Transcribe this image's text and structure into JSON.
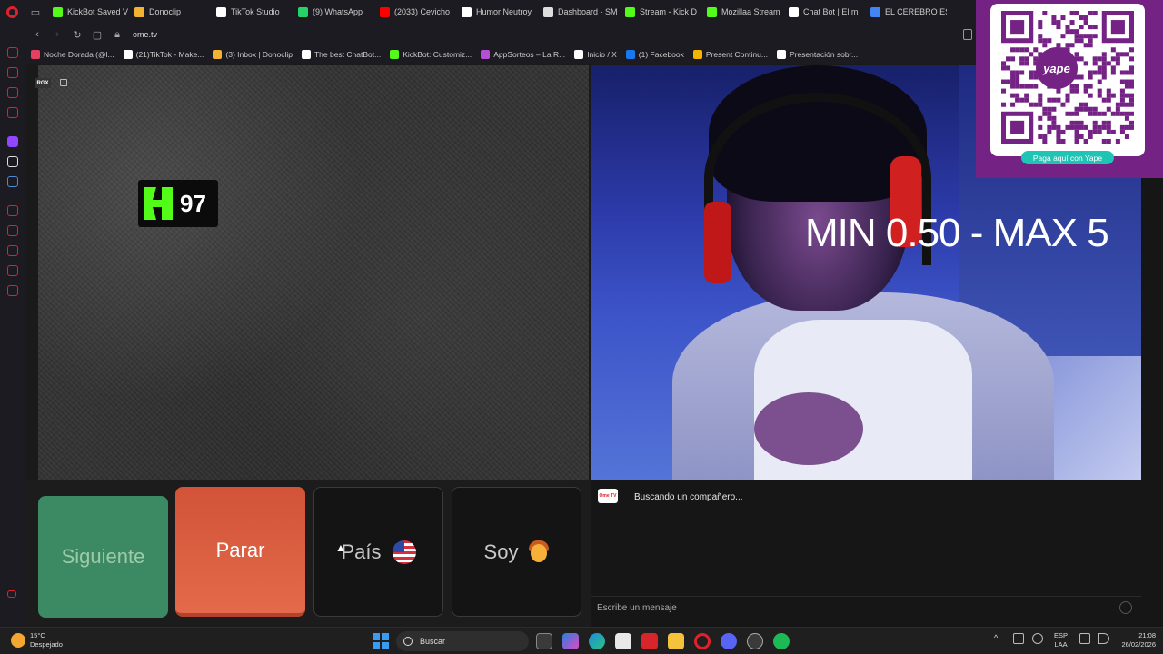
{
  "browser": {
    "tabs": [
      {
        "label": "KickBot Saved V",
        "icon": "kick-icon",
        "color": "#53fc18"
      },
      {
        "label": "Donoclip",
        "icon": "donoclip-icon",
        "color": "#f2b233"
      },
      {
        "label": "TikTok Studio",
        "icon": "tiktok-icon",
        "color": "#ffffff"
      },
      {
        "label": "(9) WhatsApp",
        "icon": "whatsapp-icon",
        "color": "#25d366"
      },
      {
        "label": "(2033) Cevicho",
        "icon": "youtube-icon",
        "color": "#ff0000"
      },
      {
        "label": "Humor Neutroy",
        "icon": "tiktok-icon",
        "color": "#ffffff"
      },
      {
        "label": "Dashboard - SM",
        "icon": "page-icon",
        "color": "#dddddd"
      },
      {
        "label": "Stream - Kick D",
        "icon": "kick-icon",
        "color": "#53fc18"
      },
      {
        "label": "Mozillaa Stream",
        "icon": "kick-icon",
        "color": "#53fc18"
      },
      {
        "label": "Chat Bot | El m",
        "icon": "chatgpt-icon",
        "color": "#ffffff"
      },
      {
        "label": "EL CEREBRO ES",
        "icon": "google-icon",
        "color": "#4285f4"
      }
    ],
    "url": "ome.tv",
    "bookmarks": [
      {
        "label": "Noche Dorada (@l...",
        "color": "#e4405f"
      },
      {
        "label": "(21)TikTok - Make...",
        "color": "#ffffff"
      },
      {
        "label": "(3) Inbox | Donoclip",
        "color": "#f2b233"
      },
      {
        "label": "The best ChatBot...",
        "color": "#ffffff"
      },
      {
        "label": "KickBot: Customiz...",
        "color": "#53fc18"
      },
      {
        "label": "AppSorteos – La R...",
        "color": "#b44fd6"
      },
      {
        "label": "Inicio / X",
        "color": "#ffffff"
      },
      {
        "label": "(1) Facebook",
        "color": "#1877f2"
      },
      {
        "label": "Present Continu...",
        "color": "#f4b400"
      },
      {
        "label": "Presentación sobr...",
        "color": "#ffffff"
      }
    ]
  },
  "stream": {
    "kick_count": "97",
    "overlay_text": "MIN 0.50 - MAX 5",
    "qr_logo": "yape",
    "qr_caption": "Paga aquí con Yape",
    "rgx_label": "RGX"
  },
  "controls": {
    "next_label": "Siguiente",
    "stop_label": "Parar",
    "country_label": "País",
    "gender_label": "Soy"
  },
  "chat": {
    "status_message": "Buscando un compañero...",
    "input_placeholder": "Escribe un mensaje",
    "logo_text": "Ome TV"
  },
  "taskbar": {
    "weather_temp": "15°C",
    "weather_desc": "Despejado",
    "search_label": "Buscar",
    "lang_line1": "ESP",
    "lang_line2": "LAA",
    "time": "21:08",
    "date": "26/02/2026"
  },
  "colors": {
    "next_button": "#3b8a64",
    "stop_button": "#d25338",
    "kick_green": "#53fc18",
    "qr_panel": "#742284"
  }
}
